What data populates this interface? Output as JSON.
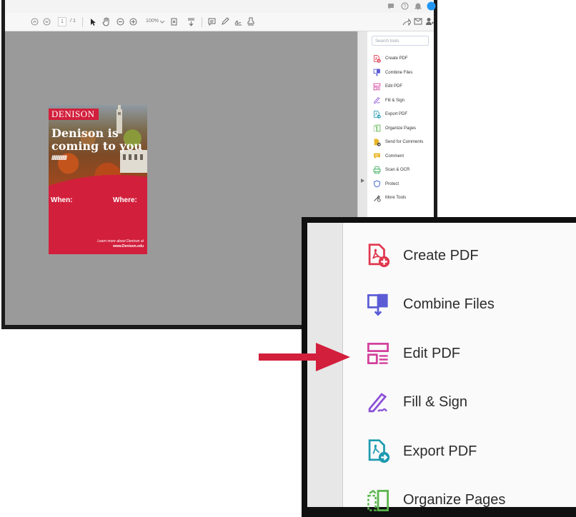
{
  "toolbar": {
    "page_current": "1",
    "page_total": "/ 1",
    "zoom_level": "100%"
  },
  "tools_pane": {
    "search_placeholder": "Search tools",
    "items": [
      {
        "label": "Create PDF",
        "icon": "create-pdf-icon",
        "color": "#e0384e"
      },
      {
        "label": "Combine Files",
        "icon": "combine-files-icon",
        "color": "#5b5bd6"
      },
      {
        "label": "Edit PDF",
        "icon": "edit-pdf-icon",
        "color": "#d23e9b"
      },
      {
        "label": "Fill & Sign",
        "icon": "fill-sign-icon",
        "color": "#8b4fd8"
      },
      {
        "label": "Export PDF",
        "icon": "export-pdf-icon",
        "color": "#1e9ab0"
      },
      {
        "label": "Organize Pages",
        "icon": "organize-pages-icon",
        "color": "#59b54a"
      },
      {
        "label": "Send for Comments",
        "icon": "send-comments-icon",
        "color": "#e9b526"
      },
      {
        "label": "Comment",
        "icon": "comment-icon",
        "color": "#e9b526"
      },
      {
        "label": "Scan & OCR",
        "icon": "scan-ocr-icon",
        "color": "#2fa84f"
      },
      {
        "label": "Protect",
        "icon": "protect-icon",
        "color": "#3f63d9"
      },
      {
        "label": "More Tools",
        "icon": "more-tools-icon",
        "color": "#444444"
      }
    ]
  },
  "poster": {
    "logo": "DENISON",
    "headline_line1": "Denison is",
    "headline_line2": "coming to you",
    "slashes": "//////////////",
    "when": "When:",
    "where": "Where:",
    "learn_line1": "Learn more about Denison at",
    "learn_line2": "www.Denison.edu"
  },
  "zoom_callout": {
    "items": [
      {
        "label": "Create PDF"
      },
      {
        "label": "Combine Files"
      },
      {
        "label": "Edit PDF"
      },
      {
        "label": "Fill & Sign"
      },
      {
        "label": "Export PDF"
      },
      {
        "label": "Organize Pages"
      }
    ],
    "highlighted": "Edit PDF",
    "arrow_color": "#d21f3c"
  }
}
